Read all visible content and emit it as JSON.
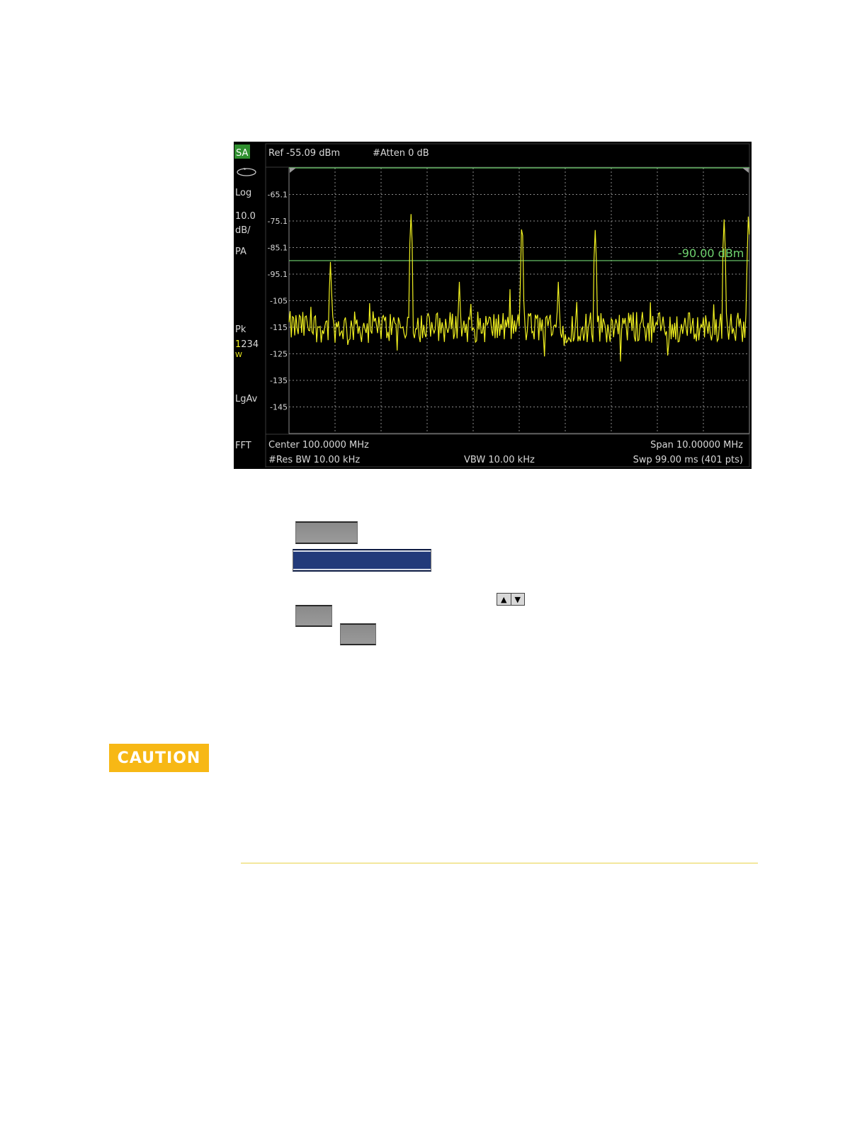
{
  "analyzer": {
    "mode": "SA",
    "ref_level": "Ref -55.09 dBm",
    "attenuation": "#Atten 0 dB",
    "left_panel": {
      "scale_type": "Log",
      "scale_value": "10.0",
      "scale_unit": "dB/",
      "preamp": "PA",
      "detector": "Pk",
      "traces": "1234",
      "trace_mode": "W",
      "average": "LgAv",
      "sweep_type": "FFT"
    },
    "threshold_label": "-90.00 dBm",
    "footer": {
      "center": "Center 100.0000 MHz",
      "span": "Span 10.00000 MHz",
      "res_bw": "#Res BW 10.00 kHz",
      "vbw": "VBW 10.00 kHz",
      "sweep": "Swp 99.00 ms (401 pts)"
    },
    "colors": {
      "trace": "#f0f020",
      "grid": "#8a8a8a",
      "threshold": "#6fd36f",
      "mode_badge": "#2f8f2f"
    }
  },
  "chart_data": {
    "type": "line",
    "xlabel": "",
    "ylabel": "",
    "y_tick_labels": [
      "-65.1",
      "-75.1",
      "-85.1",
      "-95.1",
      "-105",
      "-115",
      "-125",
      "-135",
      "-145"
    ],
    "ylim": [
      -155.09,
      -55.09
    ],
    "xlim": [
      95.0,
      105.0
    ],
    "x_unit": "MHz",
    "grid": true,
    "threshold": -90.0,
    "noise_floor": -115,
    "peaks": [
      {
        "x": 95.9,
        "y": -90.5
      },
      {
        "x": 97.65,
        "y": -72.5
      },
      {
        "x": 98.7,
        "y": -98.0
      },
      {
        "x": 100.06,
        "y": -76.5
      },
      {
        "x": 100.85,
        "y": -98.0
      },
      {
        "x": 101.65,
        "y": -78.5
      },
      {
        "x": 104.45,
        "y": -74.5
      },
      {
        "x": 104.98,
        "y": -73.0
      }
    ]
  },
  "icons": {
    "arrows": "up-down-arrows-icon",
    "rotate": "rotate-icon"
  },
  "caution_label": "CAUTION"
}
